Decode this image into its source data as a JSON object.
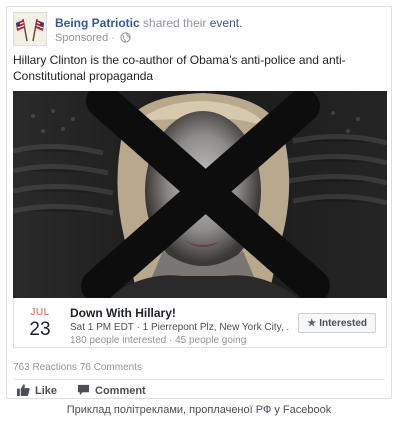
{
  "post": {
    "page_name": "Being Patriotic",
    "action_text": "shared their",
    "event_word": "event.",
    "sponsored": "Sponsored",
    "dot": "·",
    "text": "Hillary Clinton is the co-author of Obama’s anti-police and anti-Constitutional propaganda"
  },
  "event": {
    "month": "JUL",
    "day": "23",
    "title": "Down With Hillary!",
    "meta": "Sat 1 PM EDT · 1 Pierrepont Plz, New York City, ...",
    "stats": "180 people interested · 45 people going",
    "interested_label": "Interested"
  },
  "engagement": {
    "reactions": "763 Reactions",
    "comments": "76 Comments"
  },
  "actions": {
    "like": "Like",
    "comment": "Comment"
  },
  "caption": "Приклад політреклами, проплаченої РФ у Facebook",
  "icons": [
    "flags-avatar",
    "globe-icon",
    "star-icon",
    "thumbs-up-icon",
    "comment-icon"
  ],
  "colors": {
    "link": "#365899",
    "month": "#e9573f",
    "muted": "#90949c"
  }
}
